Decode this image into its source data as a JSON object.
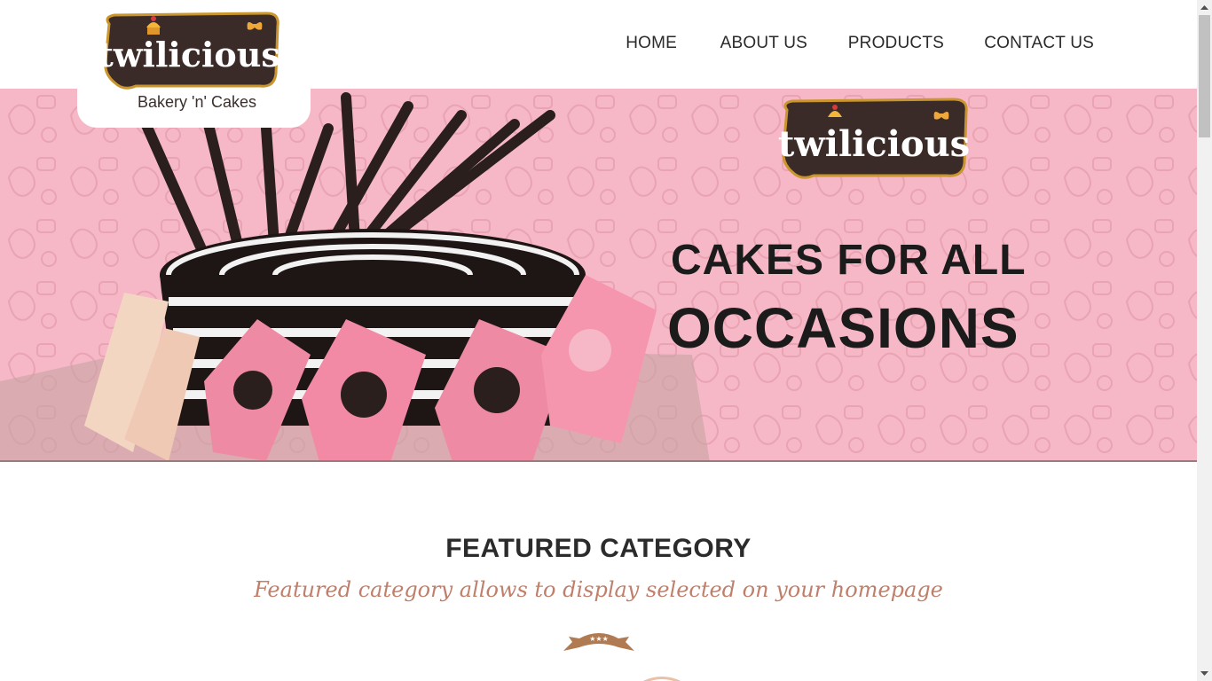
{
  "brand": {
    "name": "twilicious",
    "tagline": "Bakery 'n' Cakes"
  },
  "nav": {
    "items": [
      {
        "label": "HOME"
      },
      {
        "label": "ABOUT US"
      },
      {
        "label": "PRODUCTS"
      },
      {
        "label": "CONTACT US"
      }
    ]
  },
  "hero": {
    "brand_text": "twilicious",
    "headline_line1": "CAKES FOR ALL",
    "headline_line2": "OCCASIONS",
    "colors": {
      "background": "#f6b8c6",
      "headline": "#1b1b1b"
    }
  },
  "featured": {
    "title": "FEATURED CATEGORY",
    "subtitle": "Featured category allows to display selected on your homepage",
    "ribbon_icon": "ribbon-stars-icon",
    "colors": {
      "subtitle": "#c07f6a",
      "ribbon": "#b07a52"
    }
  },
  "icons": {
    "scroll_up": "scroll-up-arrow-icon",
    "scroll_down": "scroll-down-arrow-icon",
    "cupcake": "cupcake-icon",
    "butterfly": "butterfly-icon"
  }
}
